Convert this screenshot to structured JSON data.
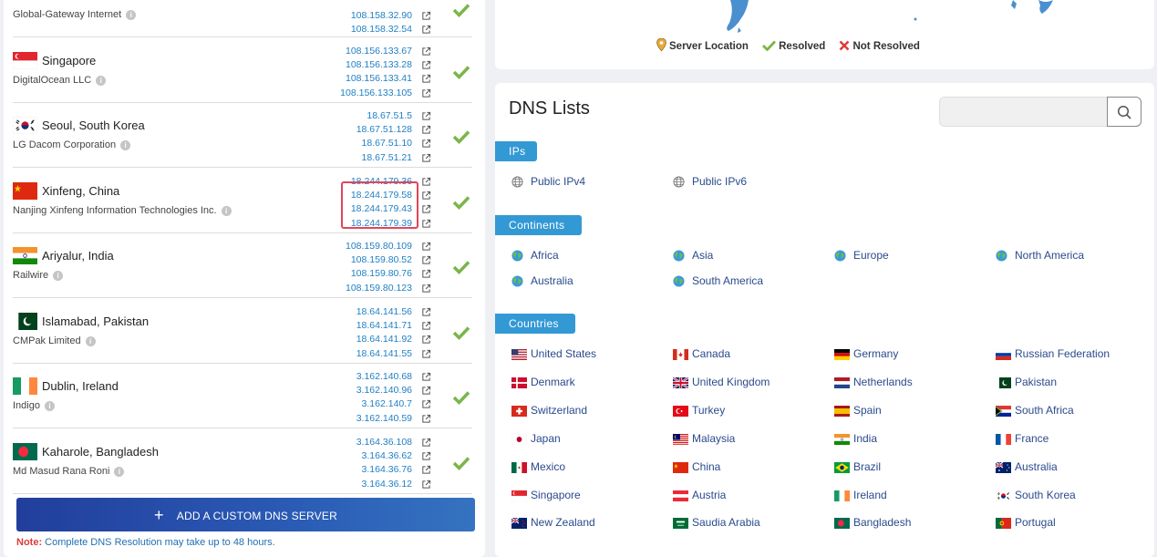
{
  "servers": [
    {
      "location": "",
      "isp": "Global-Gateway Internet",
      "ips": [
        "108.158.32.90",
        "108.158.32.54"
      ],
      "flag": "eu-blue"
    },
    {
      "location": "Singapore",
      "isp": "DigitalOcean LLC",
      "ips": [
        "108.156.133.67",
        "108.156.133.28",
        "108.156.133.41",
        "108.156.133.105"
      ],
      "flag": "sg"
    },
    {
      "location": "Seoul, South Korea",
      "isp": "LG Dacom Corporation",
      "ips": [
        "18.67.51.5",
        "18.67.51.128",
        "18.67.51.10",
        "18.67.51.21"
      ],
      "flag": "kr"
    },
    {
      "location": "Xinfeng, China",
      "isp": "Nanjing Xinfeng Information Technologies Inc.",
      "ips": [
        "18.244.179.36",
        "18.244.179.58",
        "18.244.179.43",
        "18.244.179.39"
      ],
      "flag": "cn"
    },
    {
      "location": "Ariyalur, India",
      "isp": "Railwire",
      "ips": [
        "108.159.80.109",
        "108.159.80.52",
        "108.159.80.76",
        "108.159.80.123"
      ],
      "flag": "in"
    },
    {
      "location": "Islamabad, Pakistan",
      "isp": "CMPak Limited",
      "ips": [
        "18.64.141.56",
        "18.64.141.71",
        "18.64.141.92",
        "18.64.141.55"
      ],
      "flag": "pk"
    },
    {
      "location": "Dublin, Ireland",
      "isp": "Indigo",
      "ips": [
        "3.162.140.68",
        "3.162.140.96",
        "3.162.140.7",
        "3.162.140.59"
      ],
      "flag": "ie"
    },
    {
      "location": "Kaharole, Bangladesh",
      "isp": "Md Masud Rana Roni",
      "ips": [
        "3.164.36.108",
        "3.164.36.62",
        "3.164.36.76",
        "3.164.36.12"
      ],
      "flag": "bd"
    }
  ],
  "add_button": {
    "label": "ADD A CUSTOM DNS SERVER",
    "icon": "plus-icon"
  },
  "note": {
    "label": "Note:",
    "text": " Complete DNS Resolution may take up to 48 hours."
  },
  "legend": {
    "server_location": "Server Location",
    "resolved": "Resolved",
    "not_resolved": "Not Resolved"
  },
  "dns_lists": {
    "title": "DNS Lists",
    "search_placeholder": "",
    "categories": {
      "ips": "IPs",
      "continents": "Continents",
      "countries": "Countries"
    },
    "ips": [
      "Public IPv4",
      "Public IPv6"
    ],
    "continents": [
      "Africa",
      "Asia",
      "Europe",
      "North America",
      "Australia",
      "South America"
    ],
    "countries": [
      "United States",
      "Canada",
      "Germany",
      "Russian Federation",
      "Denmark",
      "United Kingdom",
      "Netherlands",
      "Pakistan",
      "Switzerland",
      "Turkey",
      "Spain",
      "South Africa",
      "Japan",
      "Malaysia",
      "India",
      "France",
      "Mexico",
      "China",
      "Brazil",
      "Australia",
      "Singapore",
      "Austria",
      "Ireland",
      "South Korea",
      "New Zealand",
      "Saudia Arabia",
      "Bangladesh",
      "Portugal"
    ]
  },
  "colors": {
    "accent": "#3399d4",
    "link": "#1f7fc4",
    "resolved": "#7ab648",
    "not_resolved": "#e03c3c",
    "button": "#2a4fa8"
  }
}
